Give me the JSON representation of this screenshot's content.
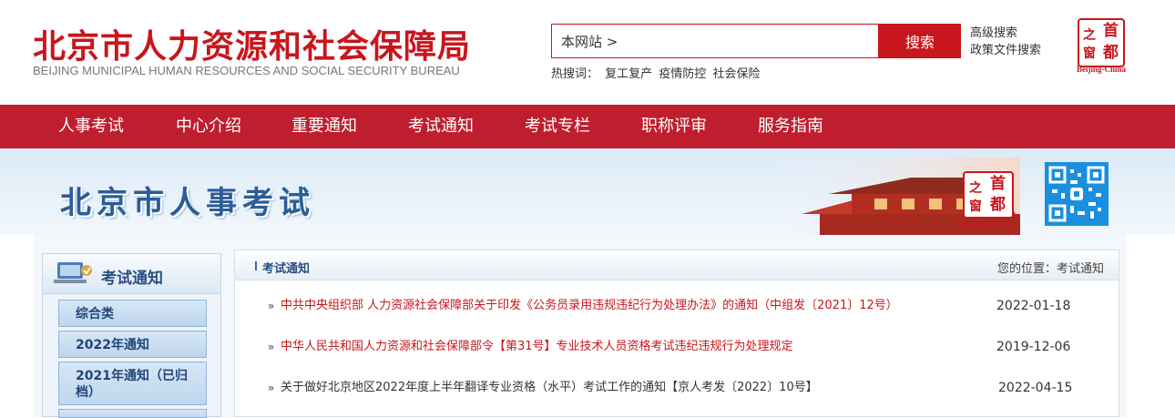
{
  "header": {
    "title": "北京市人力资源和社会保障局",
    "subtitle": "BEIJING MUNICIPAL HUMAN RESOURCES AND SOCIAL SECURITY BUREAU",
    "search": {
      "value": "本网站 >",
      "button": "搜索"
    },
    "links": [
      "高级搜索",
      "政策文件搜索"
    ],
    "hot_label": "热搜词：",
    "hot_words": [
      "复工复产",
      "疫情防控",
      "社会保险"
    ],
    "seal": {
      "chars": [
        "首",
        "都",
        "之",
        "窗"
      ],
      "caption": "Beijing-China"
    }
  },
  "nav": {
    "items": [
      "人事考试",
      "中心介绍",
      "重要通知",
      "考试通知",
      "考试专栏",
      "职称评审",
      "服务指南"
    ]
  },
  "banner": {
    "title": "北京市人事考试",
    "seal": {
      "chars": [
        "首",
        "都",
        "之",
        "窗"
      ],
      "caption": "Beijing-China"
    }
  },
  "sidebar": {
    "title": "考试通知",
    "items": [
      "综合类",
      "2022年通知",
      "2021年通知（已归档）"
    ]
  },
  "main": {
    "title": "考试通知",
    "breadcrumb": "您的位置：考试通知",
    "bullet": "»",
    "items": [
      {
        "title": "中共中央组织部 人力资源社会保障部关于印发《公务员录用违规违纪行为处理办法》的通知（中组发〔2021〕12号）",
        "date": "2022-01-18",
        "color": "#c8161d"
      },
      {
        "title": "中华人民共和国人力资源和社会保障部令【第31号】专业技术人员资格考试违纪违规行为处理规定",
        "date": "2019-12-06",
        "color": "#c8161d"
      },
      {
        "title": "关于做好北京地区2022年度上半年翻译专业资格（水平）考试工作的通知【京人考发〔2022〕10号】",
        "date": "2022-04-15",
        "color": "#333333"
      }
    ]
  },
  "colors": {
    "brand_red": "#c8161d",
    "nav_red": "#bf1e2e",
    "link_blue": "#2a4f85"
  }
}
